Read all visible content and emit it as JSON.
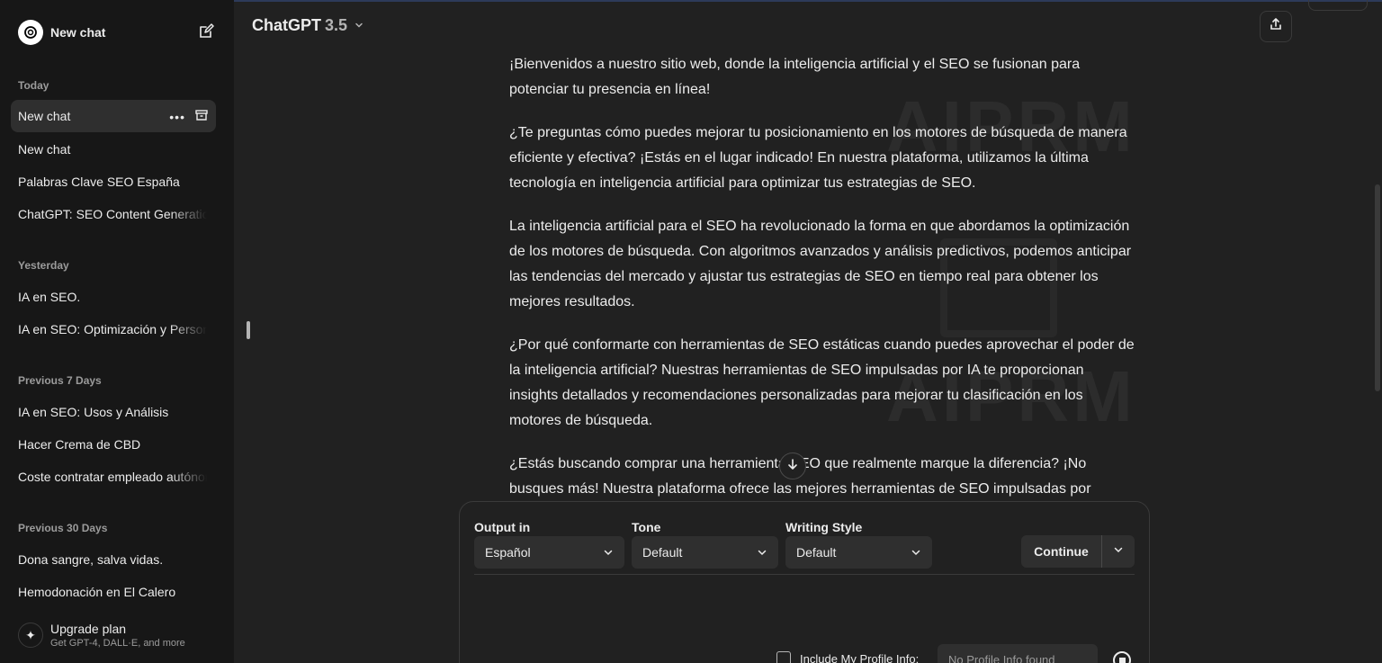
{
  "sidebar": {
    "new_chat_label": "New chat",
    "sections": [
      {
        "title": "Today",
        "items": [
          "New chat",
          "New chat",
          "Palabras Clave SEO España",
          "ChatGPT: SEO Content Generation"
        ]
      },
      {
        "title": "Yesterday",
        "items": [
          "IA en SEO.",
          "IA en SEO: Optimización y Personalización"
        ]
      },
      {
        "title": "Previous 7 Days",
        "items": [
          "IA en SEO: Usos y Análisis",
          "Hacer Crema de CBD",
          "Coste contratar empleado autónomo"
        ]
      },
      {
        "title": "Previous 30 Days",
        "items": [
          "Dona sangre, salva vidas.",
          "Hemodonación en El Calero"
        ]
      }
    ],
    "upgrade": {
      "title": "Upgrade plan",
      "subtitle": "Get GPT-4, DALL·E, and more"
    }
  },
  "header": {
    "model_name": "ChatGPT",
    "model_version": "3.5"
  },
  "content": {
    "paragraphs": [
      "¡Bienvenidos a nuestro sitio web, donde la inteligencia artificial y el SEO se fusionan para potenciar tu presencia en línea!",
      "¿Te preguntas cómo puedes mejorar tu posicionamiento en los motores de búsqueda de manera eficiente y efectiva? ¡Estás en el lugar indicado! En nuestra plataforma, utilizamos la última tecnología en inteligencia artificial para optimizar tus estrategias de SEO.",
      "La inteligencia artificial para el SEO ha revolucionado la forma en que abordamos la optimización de los motores de búsqueda. Con algoritmos avanzados y análisis predictivos, podemos anticipar las tendencias del mercado y ajustar tus estrategias de SEO en tiempo real para obtener los mejores resultados.",
      "¿Por qué conformarte con herramientas de SEO estáticas cuando puedes aprovechar el poder de la inteligencia artificial? Nuestras herramientas de SEO impulsadas por IA te proporcionan insights detallados y recomendaciones personalizadas para mejorar tu clasificación en los motores de búsqueda.",
      "¿Estás buscando comprar una herramienta SEO que realmente marque la diferencia? ¡No busques más! Nuestra plataforma ofrece las mejores herramientas de SEO impulsadas por"
    ],
    "watermark_text": "AIPRM"
  },
  "panel": {
    "output_label": "Output in",
    "output_value": "Español",
    "tone_label": "Tone",
    "tone_value": "Default",
    "style_label": "Writing Style",
    "style_value": "Default",
    "continue_label": "Continue",
    "profile_label": "Include My Profile Info:",
    "profile_value": "No Profile Info found"
  },
  "icons": [
    "openai-logo-icon",
    "edit-icon",
    "more-dots-icon",
    "archive-icon",
    "sparkle-icon",
    "chevron-down-icon",
    "share-icon",
    "arrow-down-icon",
    "stop-icon"
  ]
}
